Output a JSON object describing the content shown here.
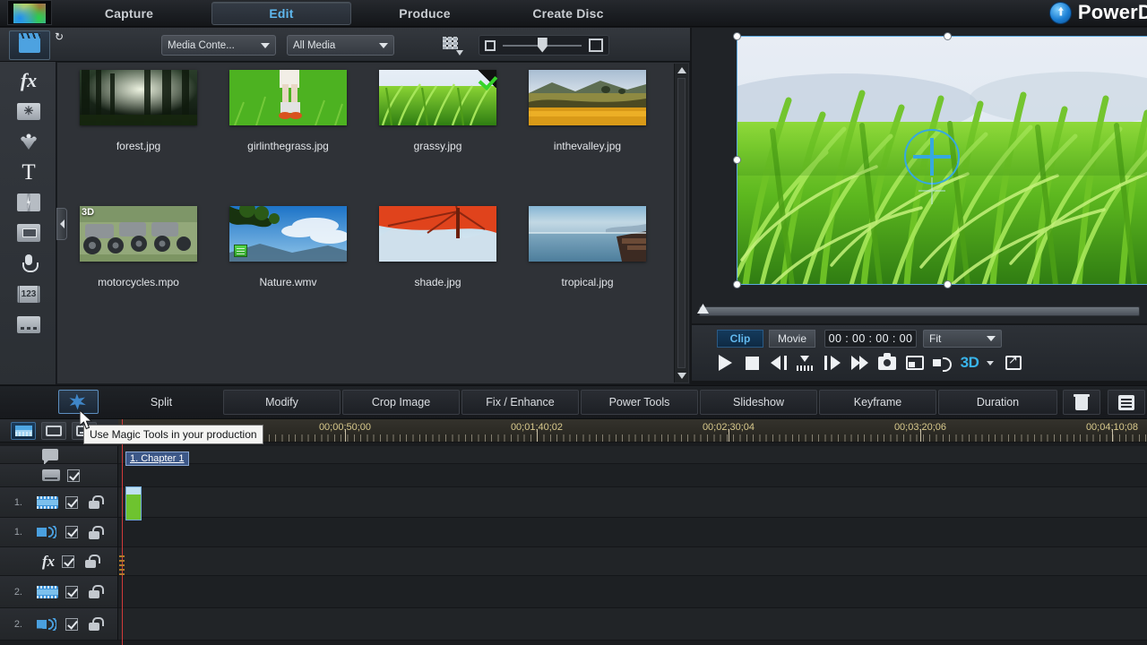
{
  "app": {
    "brand": "PowerD",
    "tabs": [
      {
        "label": "Capture",
        "active": false
      },
      {
        "label": "Edit",
        "active": true
      },
      {
        "label": "Produce",
        "active": false
      },
      {
        "label": "Create Disc",
        "active": false
      }
    ]
  },
  "media_toolbar": {
    "library_icon": "clapperboard-icon",
    "import_label": "import-media-icon",
    "plugin_label": "plugin-icon",
    "content_dropdown": "Media Conte...",
    "filter_dropdown": "All Media",
    "sort_icon": "sort-grid-icon",
    "zoom_small_icon": "small-thumbnail-icon",
    "zoom_large_icon": "large-thumbnail-icon"
  },
  "rail": {
    "items": [
      {
        "name": "media-room",
        "icon": "clapperboard-icon",
        "active": true
      },
      {
        "name": "effect-room",
        "icon": "fx-icon",
        "active": false
      },
      {
        "name": "pip-objects-room",
        "icon": "pip-object-icon",
        "active": false
      },
      {
        "name": "particle-room",
        "icon": "particle-icon",
        "active": false
      },
      {
        "name": "title-room",
        "icon": "title-T-icon",
        "active": false
      },
      {
        "name": "transition-room",
        "icon": "transition-icon",
        "active": false
      },
      {
        "name": "audio-mixing-room",
        "icon": "mixer-icon",
        "active": false
      },
      {
        "name": "voice-over-room",
        "icon": "microphone-icon",
        "active": false
      },
      {
        "name": "chapter-room",
        "icon": "chapter-123-icon",
        "active": false
      },
      {
        "name": "subtitle-room",
        "icon": "subtitle-icon",
        "active": false
      }
    ]
  },
  "library": {
    "items": [
      {
        "name": "forest.jpg",
        "badge": "none"
      },
      {
        "name": "girlinthegrass.jpg",
        "badge": "none"
      },
      {
        "name": "grassy.jpg",
        "badge": "check"
      },
      {
        "name": "inthevalley.jpg",
        "badge": "none"
      },
      {
        "name": "motorcycles.mpo",
        "badge": "3d",
        "badge_text": "3D"
      },
      {
        "name": "Nature.wmv",
        "badge": "mini"
      },
      {
        "name": "shade.jpg",
        "badge": "none"
      },
      {
        "name": "tropical.jpg",
        "badge": "none"
      }
    ]
  },
  "player": {
    "clip_label": "Clip",
    "movie_label": "Movie",
    "timecode": "00 : 00 : 00 : 00",
    "fit_label": "Fit",
    "three_d_label": "3D",
    "controls": [
      "play-icon",
      "stop-icon",
      "previous-frame-icon",
      "set-marker-icon",
      "next-frame-icon",
      "fast-forward-icon",
      "snapshot-icon",
      "capture-icon",
      "volume-icon",
      "3d-toggle",
      "expand-icon"
    ]
  },
  "edit_toolbar": {
    "magic_icon": "magic-tools-icon",
    "buttons": [
      "Split",
      "Modify",
      "Crop Image",
      "Fix / Enhance",
      "Power Tools",
      "Slideshow",
      "Keyframe",
      "Duration"
    ],
    "delete_icon": "trash-icon",
    "properties_icon": "properties-list-icon"
  },
  "tooltip": {
    "text": "Use Magic Tools in your production"
  },
  "timeline": {
    "view_buttons": [
      {
        "name": "timeline-view",
        "icon": "timeline-icon",
        "active": true
      },
      {
        "name": "storyboard-view",
        "icon": "storyboard-icon",
        "active": false
      },
      {
        "name": "script-view",
        "icon": "script-icon",
        "active": false
      }
    ],
    "ruler_labels": [
      "00:00:50:00",
      "00:01:40:02",
      "00:02:30:04",
      "00:03:20:06",
      "00:04:10:08"
    ],
    "chapter_marker": "1. Chapter 1",
    "tracks": [
      {
        "num": "",
        "icon": "chapter-marker-icon",
        "has_check": false,
        "has_lock": false
      },
      {
        "num": "",
        "icon": "subtitle-track-icon",
        "has_check": true,
        "has_lock": false
      },
      {
        "num": "1.",
        "icon": "video-track-icon",
        "has_check": true,
        "has_lock": true
      },
      {
        "num": "1.",
        "icon": "audio-track-icon",
        "has_check": true,
        "has_lock": true
      },
      {
        "num": "",
        "icon": "fx-track-icon",
        "has_check": true,
        "has_lock": true
      },
      {
        "num": "2.",
        "icon": "video-track-icon",
        "has_check": true,
        "has_lock": true
      },
      {
        "num": "2.",
        "icon": "audio-track-icon",
        "has_check": true,
        "has_lock": true
      }
    ]
  },
  "colors": {
    "accent_blue": "#5fb8ee",
    "panel_bg": "#2f3237",
    "window_bg": "#1a1c1f",
    "ruler_text": "#d8c98c",
    "playhead_red": "#d03a3a",
    "check_green": "#35d42a"
  }
}
